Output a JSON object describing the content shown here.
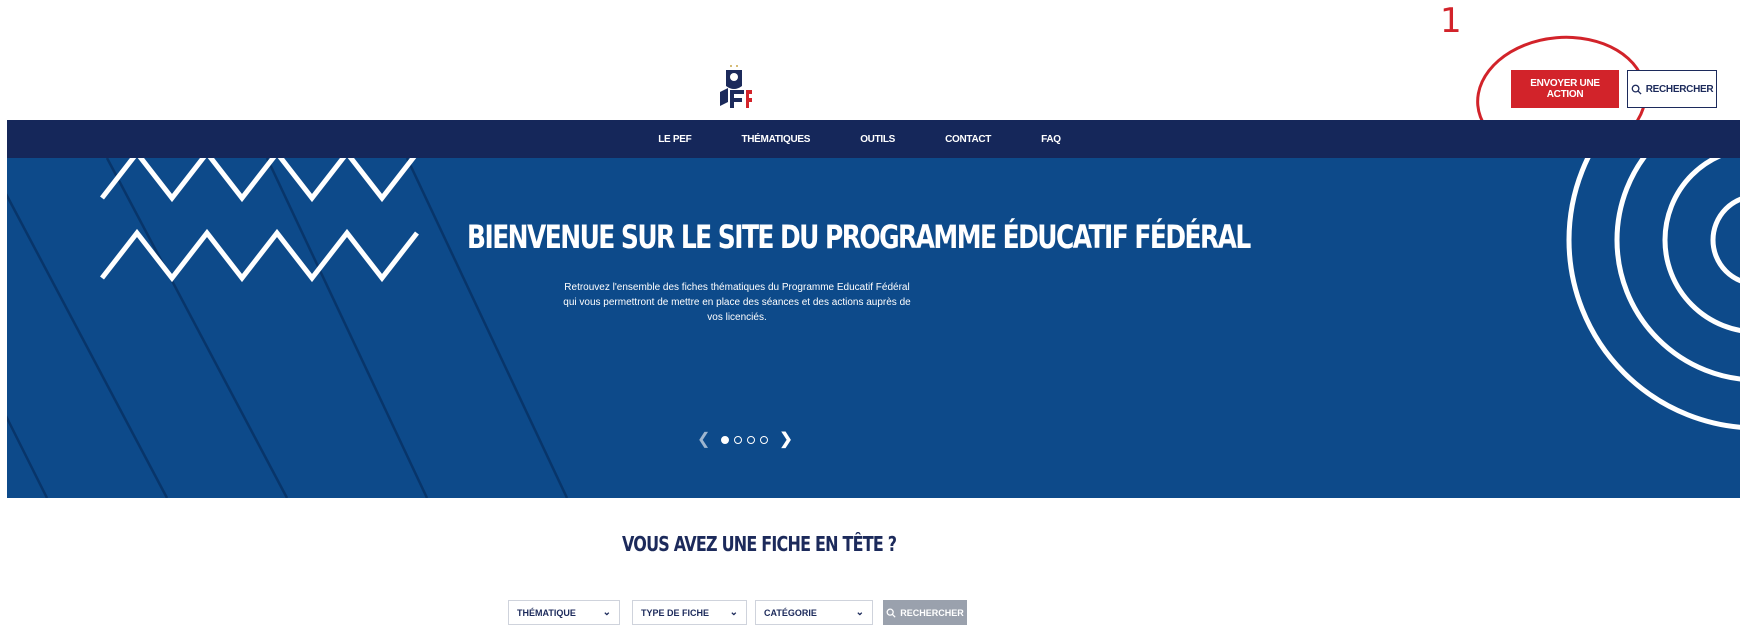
{
  "annotation": {
    "number": "1"
  },
  "header": {
    "send_action_label": "ENVOYER UNE ACTION",
    "search_label": "RECHERCHER",
    "logo_text": "FFF PEF"
  },
  "nav": {
    "items": [
      "LE PEF",
      "THÉMATIQUES",
      "OUTILS",
      "CONTACT",
      "FAQ"
    ]
  },
  "hero": {
    "title": "BIENVENUE SUR LE SITE DU PROGRAMME ÉDUCATIF FÉDÉRAL",
    "subtitle": "Retrouvez l'ensemble des fiches thématiques du Programme Educatif Fédéral qui vous permettront de mettre en place des séances et des actions auprès de vos licenciés.",
    "carousel": {
      "count": 4,
      "active": 1
    }
  },
  "finder": {
    "title": "VOUS AVEZ UNE FICHE EN TÊTE ?",
    "filters": [
      "THÉMATIQUE",
      "TYPE DE FICHE",
      "CATÉGORIE"
    ],
    "search_label": "RECHERCHER"
  },
  "colors": {
    "navy": "#15275a",
    "hero_blue": "#0d4a8a",
    "red": "#d2232a",
    "button_gray": "#9aa1ad"
  }
}
